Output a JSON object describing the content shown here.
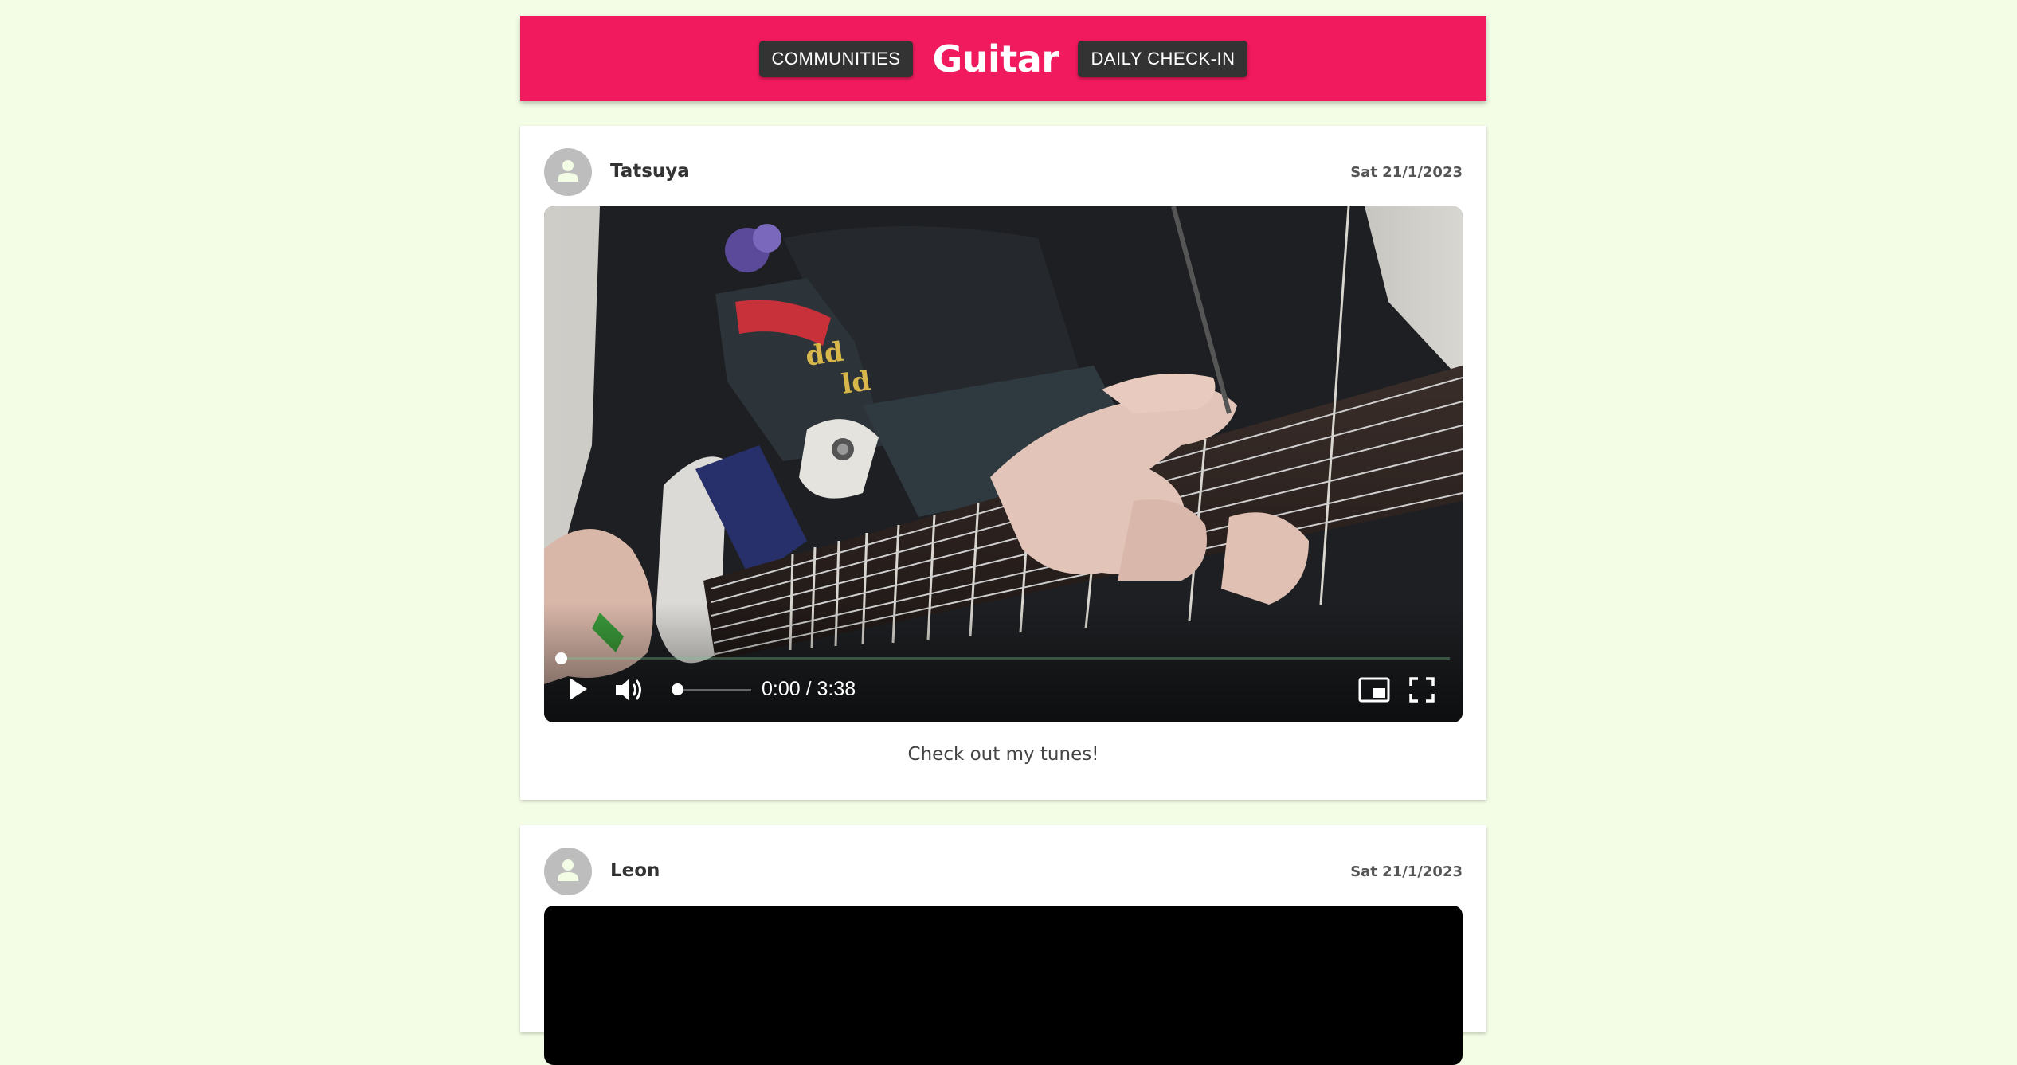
{
  "header": {
    "communities_label": "COMMUNITIES",
    "title": "Guitar",
    "checkin_label": "DAILY CHECK-IN"
  },
  "posts": [
    {
      "username": "Tatsuya",
      "date": "Sat 21/1/2023",
      "video": {
        "time": "0:00 / 3:38",
        "progress": 0,
        "volume": 0
      },
      "caption": "Check out my tunes!"
    },
    {
      "username": "Leon",
      "date": "Sat 21/1/2023"
    }
  ],
  "colors": {
    "page_background": "#f3fde6",
    "header_background": "#f21a5e",
    "button_background": "#333333",
    "avatar_background": "#bdbdbd",
    "avatar_glyph": "#f3fde6"
  },
  "icons": {
    "avatar": "person-icon",
    "play": "play-icon",
    "volume": "volume-icon",
    "pip": "picture-in-picture-icon",
    "fullscreen": "fullscreen-icon"
  }
}
